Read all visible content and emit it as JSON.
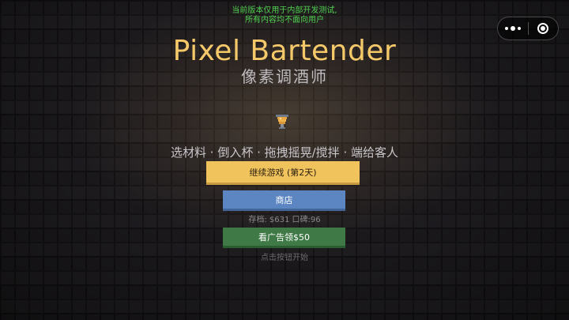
{
  "notice": {
    "line1": "当前版本仅用于内部开发测试,",
    "line2": "所有内容均不面向用户"
  },
  "capsule": {
    "more_icon": "more-dots-icon",
    "close_icon": "target-circle-icon"
  },
  "title": "Pixel Bartender",
  "subtitle": "像素调酒师",
  "trophy_icon": "trophy-icon",
  "instructions": "选材料 · 倒入杯 · 拖拽摇晃/搅拌 · 端给客人",
  "buttons": {
    "continue": "继续游戏 (第2天)",
    "shop": "商店",
    "ad_reward": "看广告领$50"
  },
  "stats": "存档: $631 口碑:96",
  "hint": "点击按钮开始",
  "colors": {
    "title": "#f5c96a",
    "continue_button": "#f1c35c",
    "shop_button": "#5b86c2",
    "ad_button": "#3f7a46",
    "notice_text": "#4fd04f",
    "background": "#1c1a1d"
  }
}
